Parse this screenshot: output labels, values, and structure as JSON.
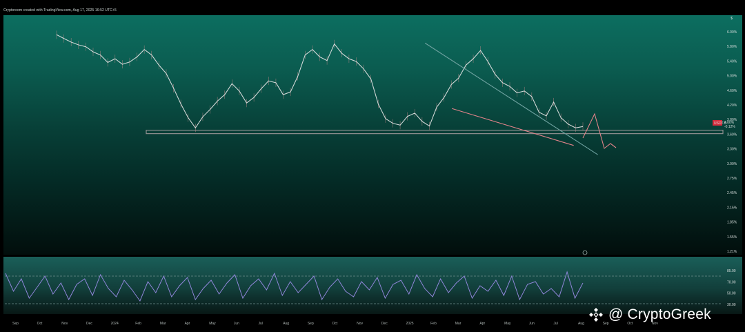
{
  "header": {
    "watermark": "Cryptoroom created with TradingView.com, Aug 17, 2025 16:52 UTC+5",
    "corner_tag": "$"
  },
  "brand": {
    "text": "@ CryptoGreek",
    "icon": "binance-square-icon"
  },
  "colors": {
    "price_line": "#e6e6e6",
    "price_wick": "#c88b8b",
    "support": "#8f8f8f",
    "upper_trend": "#6fa2a0",
    "lower_trend": "#e3838a",
    "rsi": "#8f86d9",
    "price_label_bg": "#d62b3c"
  },
  "chart_data": [
    {
      "type": "line",
      "title": "",
      "xlabel": "",
      "ylabel": "",
      "x_ticks": [
        "Sep",
        "Oct",
        "Nov",
        "Dec",
        "2024",
        "Feb",
        "Mar",
        "Apr",
        "May",
        "Jun",
        "Jul",
        "Aug",
        "Sep",
        "Oct",
        "Nov",
        "Dec",
        "2025",
        "Feb",
        "Mar",
        "Apr",
        "May",
        "Jun",
        "Jul",
        "Aug",
        "Sep",
        "Oct",
        "Nov"
      ],
      "y_ticks": [
        "6.00%",
        "5.80%",
        "5.40%",
        "5.00%",
        "4.60%",
        "4.20%",
        "3.80%",
        "3.60%",
        "3.30%",
        "3.00%",
        "2.75%",
        "2.45%",
        "2.15%",
        "1.85%",
        "1.55%",
        "1.21%"
      ],
      "ylim": [
        1.21,
        6.0
      ],
      "price_label": {
        "value": "USDT.D",
        "sub_a": "4.00%",
        "sub_b": "-0.12%"
      },
      "series": [
        {
          "values": [
            5.92,
            5.84,
            5.76,
            5.7,
            5.66,
            5.55,
            5.48,
            5.32,
            5.4,
            5.28,
            5.33,
            5.44,
            5.6,
            5.48,
            5.26,
            5.08,
            4.76,
            4.42,
            4.12,
            3.9,
            4.14,
            4.3,
            4.48,
            4.62,
            4.86,
            4.7,
            4.44,
            4.56,
            4.75,
            4.92,
            4.88,
            4.62,
            4.68,
            5.02,
            5.48,
            5.6,
            5.44,
            5.36,
            5.72,
            5.52,
            5.4,
            5.34,
            5.18,
            4.96,
            4.42,
            4.1,
            4.0,
            3.96,
            4.15,
            4.22,
            4.04,
            3.94,
            4.35,
            4.56,
            4.84,
            4.98,
            5.26,
            5.4,
            5.58,
            5.34,
            5.06,
            4.88,
            4.8,
            4.66,
            4.7,
            4.58,
            4.24,
            4.16,
            4.46,
            4.12,
            3.98,
            3.9,
            3.93
          ]
        }
      ],
      "support_level": 3.82,
      "trendlines": [
        {
          "name": "",
          "from": [
            0.657,
            5.74
          ],
          "to": [
            0.965,
            3.32
          ]
        },
        {
          "name": "",
          "from": [
            0.705,
            4.32
          ],
          "to": [
            0.922,
            3.52
          ]
        }
      ]
    },
    {
      "type": "line",
      "title": "",
      "y_ticks": [
        "85.00",
        "70.00",
        "50.00",
        "30.00"
      ],
      "ylim": [
        20,
        90
      ],
      "series": [
        {
          "values": [
            74,
            48,
            66,
            38,
            54,
            70,
            44,
            60,
            36,
            58,
            66,
            42,
            72,
            52,
            40,
            64,
            50,
            34,
            62,
            46,
            70,
            40,
            56,
            68,
            36,
            52,
            64,
            44,
            60,
            72,
            38,
            56,
            66,
            50,
            74,
            42,
            62,
            46,
            58,
            70,
            36,
            54,
            66,
            48,
            40,
            62,
            50,
            68,
            38,
            58,
            64,
            44,
            72,
            52,
            40,
            66,
            46,
            60,
            70,
            38,
            56,
            48,
            64,
            42,
            70,
            36,
            58,
            62,
            44,
            52,
            40,
            76,
            38,
            60
          ]
        }
      ],
      "levels": [
        70,
        30
      ]
    }
  ]
}
